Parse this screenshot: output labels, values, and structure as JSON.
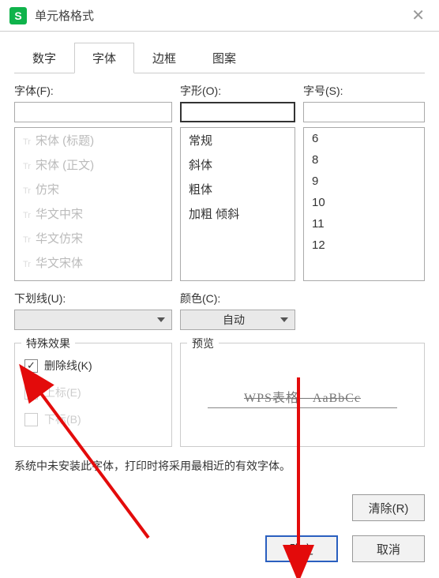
{
  "window": {
    "title": "单元格格式",
    "icon_letter": "S"
  },
  "tabs": {
    "items": [
      {
        "label": "数字",
        "active": false
      },
      {
        "label": "字体",
        "active": true
      },
      {
        "label": "边框",
        "active": false
      },
      {
        "label": "图案",
        "active": false
      }
    ]
  },
  "font": {
    "label": "字体(F):",
    "value": "",
    "options": [
      "宋体 (标题)",
      "宋体 (正文)",
      "仿宋",
      "华文中宋",
      "华文仿宋",
      "华文宋体"
    ]
  },
  "style": {
    "label": "字形(O):",
    "value": "",
    "options": [
      "常规",
      "斜体",
      "粗体",
      "加粗 倾斜"
    ]
  },
  "size": {
    "label": "字号(S):",
    "value": "",
    "options": [
      "6",
      "8",
      "9",
      "10",
      "11",
      "12"
    ]
  },
  "underline": {
    "label": "下划线(U):",
    "value": ""
  },
  "color": {
    "label": "颜色(C):",
    "value": "自动"
  },
  "effects": {
    "legend": "特殊效果",
    "strikethrough": {
      "label": "删除线(K)",
      "checked": true,
      "enabled": true
    },
    "superscript": {
      "label": "上标(E)",
      "checked": false,
      "enabled": false
    },
    "subscript": {
      "label": "下标(B)",
      "checked": false,
      "enabled": false
    }
  },
  "preview": {
    "legend": "预览",
    "sample_text": "WPS表格　AaBbCc"
  },
  "note": "系统中未安装此字体，打印时将采用最相近的有效字体。",
  "buttons": {
    "clear": "清除(R)",
    "ok": "确定",
    "cancel": "取消"
  }
}
